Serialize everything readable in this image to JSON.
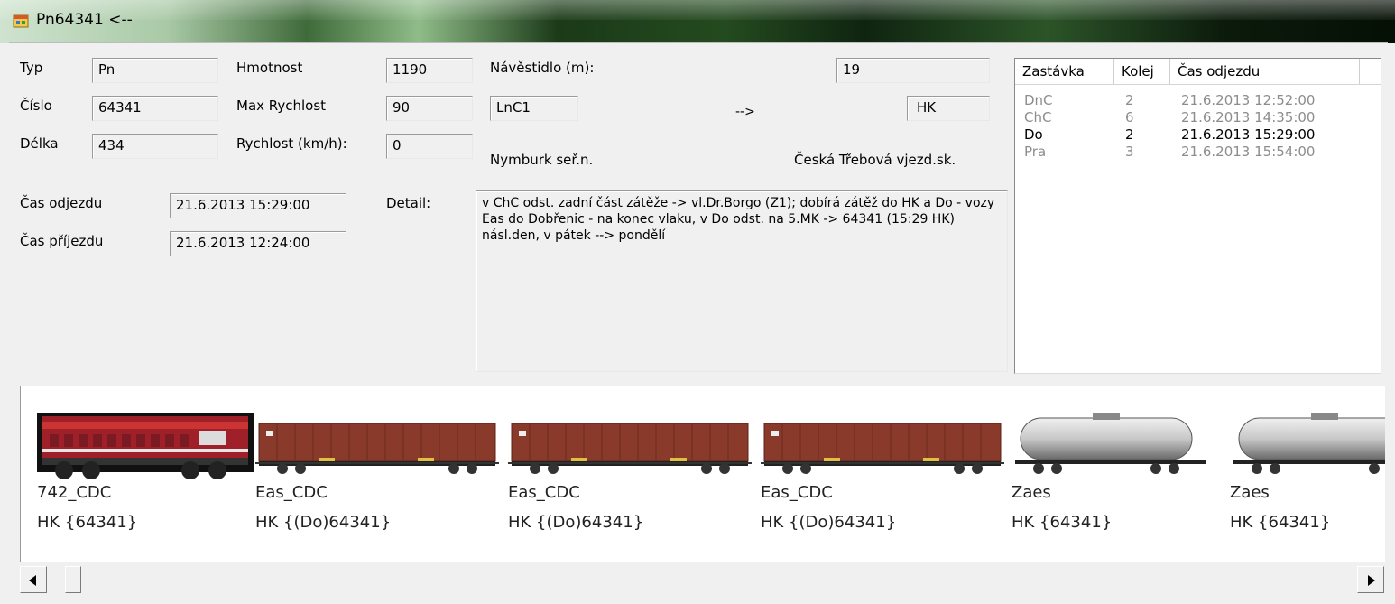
{
  "window": {
    "title": "Pn64341 <--",
    "icon": "app-window-icon"
  },
  "fields": {
    "typ": {
      "label": "Typ",
      "value": "Pn"
    },
    "cislo": {
      "label": "Číslo",
      "value": "64341"
    },
    "delka": {
      "label": "Délka",
      "value": "434"
    },
    "hmotnost": {
      "label": "Hmotnost",
      "value": "1190"
    },
    "max_rychlost": {
      "label": "Max Rychlost",
      "value": "90"
    },
    "rychlost": {
      "label": "Rychlost (km/h):",
      "value": "0"
    },
    "navestidlo": {
      "label": "Návěstidlo (m):",
      "value": "19"
    },
    "from_code": "LnC1",
    "arrow": "-->",
    "to_code": "HK",
    "from_name": "Nymburk seř.n.",
    "to_name": "Česká Třebová vjezd.sk.",
    "cas_odjezdu": {
      "label": "Čas odjezdu",
      "value": "21.6.2013 15:29:00"
    },
    "cas_prijezdu": {
      "label": "Čas příjezdu",
      "value": "21.6.2013 12:24:00"
    },
    "detail": {
      "label": "Detail:",
      "value": "v ChC odst. zadní část zátěže -> vl.Dr.Borgo (Z1); dobírá zátěž do HK a Do - vozy Eas do Dobřenic - na konec vlaku, v Do odst. na 5.MK -> 64341 (15:29 HK) násl.den, v pátek --> pondělí"
    }
  },
  "stops": {
    "headers": [
      "Zastávka",
      "Kolej",
      "Čas odjezdu"
    ],
    "rows": [
      {
        "stop": "DnC",
        "track": "2",
        "time": "21.6.2013 12:52:00",
        "state": "past"
      },
      {
        "stop": "ChC",
        "track": "6",
        "time": "21.6.2013 14:35:00",
        "state": "past"
      },
      {
        "stop": "Do",
        "track": "2",
        "time": "21.6.2013 15:29:00",
        "state": "current"
      },
      {
        "stop": "Pra",
        "track": "3",
        "time": "21.6.2013 15:54:00",
        "state": "past"
      }
    ]
  },
  "wagons": [
    {
      "type": "locomotive",
      "name": "742_CDC",
      "dest": "HK {64341}",
      "color": "#a0202a"
    },
    {
      "type": "boxcar",
      "name": "Eas_CDC",
      "dest": "HK {(Do)64341}",
      "color": "#8a3a2a"
    },
    {
      "type": "boxcar",
      "name": "Eas_CDC",
      "dest": "HK {(Do)64341}",
      "color": "#8a3a2a"
    },
    {
      "type": "boxcar",
      "name": "Eas_CDC",
      "dest": "HK {(Do)64341}",
      "color": "#8a3a2a"
    },
    {
      "type": "tank",
      "name": "Zaes",
      "dest": "HK {64341}",
      "color": "#c8c8c8"
    },
    {
      "type": "tank",
      "name": "Zaes",
      "dest": "HK {64341}",
      "color": "#c8c8c8"
    }
  ],
  "scrollbar": {
    "left_icon": "arrow-left-icon",
    "right_icon": "arrow-right-icon"
  }
}
